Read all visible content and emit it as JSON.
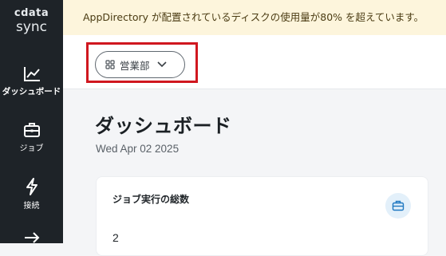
{
  "app": {
    "logo_top": "cdata",
    "logo_bottom": "sync"
  },
  "sidebar": {
    "items": [
      {
        "label": "ダッシュボード",
        "icon": "chart-line-icon",
        "active": true
      },
      {
        "label": "ジョブ",
        "icon": "briefcase-icon",
        "active": false
      },
      {
        "label": "接続",
        "icon": "plug-bolt-icon",
        "active": false
      },
      {
        "label": "",
        "icon": "arrow-right-icon",
        "active": false
      }
    ]
  },
  "banner": {
    "text": "AppDirectory が配置されているディスクの使用量が80% を超えています。"
  },
  "org_selector": {
    "label": "営業部",
    "icon": "grid-icon"
  },
  "page": {
    "title": "ダッシュボード",
    "date": "Wed Apr 02 2025"
  },
  "card": {
    "title": "ジョブ実行の総数",
    "value": "2",
    "icon": "briefcase-icon"
  },
  "colors": {
    "sidebar_bg": "#1e2328",
    "banner_bg": "#fdf5dc",
    "highlight": "#d0171f",
    "icon_accent": "#1f78c1"
  }
}
